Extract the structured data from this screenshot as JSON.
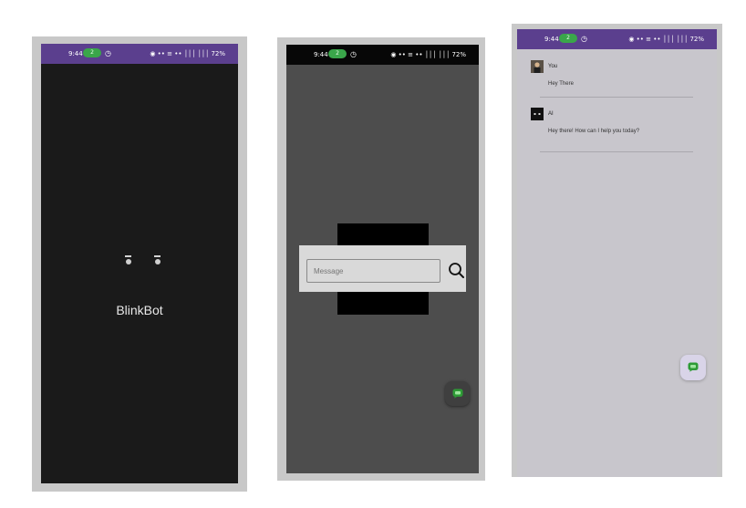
{
  "status_bar": {
    "time": "9:44",
    "badge": "2",
    "right": "◉ •• ≡ •• │││ │││ 72%"
  },
  "splash": {
    "app_name": "BlinkBot"
  },
  "message_screen": {
    "input_placeholder": "Message"
  },
  "chat": {
    "messages": [
      {
        "sender": "You",
        "text": "Hey There"
      },
      {
        "sender": "AI",
        "text": "Hey there!  How can I help you today?"
      }
    ]
  },
  "colors": {
    "status_bar": "#5b3f8e",
    "splash_bg": "#1a1a1a",
    "chat_bg": "#c8c6cc",
    "chat_icon": "#2e9b36"
  },
  "icons": [
    "search-icon",
    "chat-icon",
    "alarm-icon"
  ]
}
